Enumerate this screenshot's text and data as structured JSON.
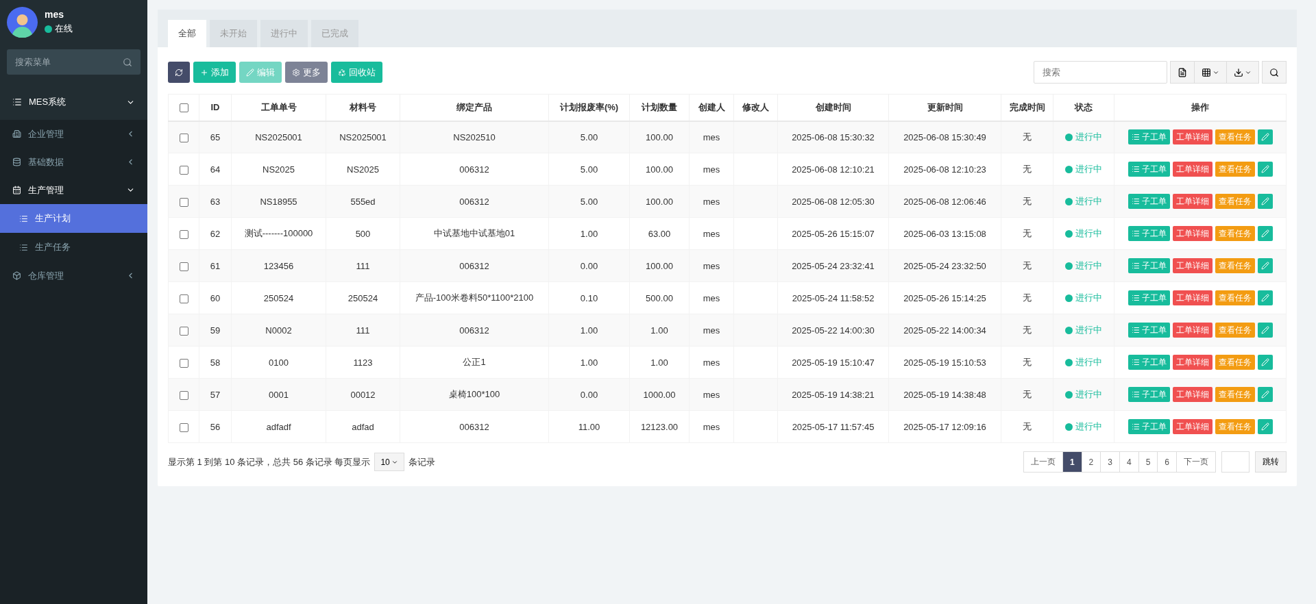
{
  "user": {
    "name": "mes",
    "status": "在线",
    "online": true
  },
  "sidebar": {
    "search_placeholder": "搜索菜单",
    "items": [
      {
        "label": "MES系统",
        "expanded": true,
        "selected": false,
        "children": [
          {
            "label": "企业管理",
            "expanded": false,
            "selected": false
          },
          {
            "label": "基础数据",
            "expanded": false,
            "selected": false
          },
          {
            "label": "生产管理",
            "expanded": true,
            "selected": false,
            "children": [
              {
                "label": "生产计划",
                "selected": true
              },
              {
                "label": "生产任务",
                "selected": false
              }
            ]
          },
          {
            "label": "仓库管理",
            "expanded": false,
            "selected": false
          }
        ]
      }
    ]
  },
  "tabs": [
    {
      "label": "全部",
      "selected": true
    },
    {
      "label": "未开始",
      "selected": false
    },
    {
      "label": "进行中",
      "selected": false
    },
    {
      "label": "已完成",
      "selected": false
    }
  ],
  "toolbar": {
    "buttons": [
      {
        "kind": "refresh",
        "disabled": false
      },
      {
        "kind": "add",
        "label": "添加",
        "disabled": false
      },
      {
        "kind": "edit",
        "label": "编辑",
        "disabled": true
      },
      {
        "kind": "more",
        "label": "更多",
        "disabled": false
      },
      {
        "kind": "recycle",
        "label": "回收站",
        "disabled": false
      }
    ],
    "search_placeholder": "搜索"
  },
  "table": {
    "select_all_checked": false,
    "columns": [
      "ID",
      "工单单号",
      "材料号",
      "绑定产品",
      "计划报废率(%)",
      "计划数量",
      "创建人",
      "修改人",
      "创建时间",
      "更新时间",
      "完成时间",
      "状态",
      "操作"
    ],
    "rows": [
      {
        "checked": false,
        "cells": [
          "65",
          "NS2025001",
          "NS2025001",
          "NS202510",
          "5.00",
          "100.00",
          "mes",
          "",
          "2025-06-08 15:30:32",
          "2025-06-08 15:30:49",
          "无"
        ],
        "status": {
          "kind": "running",
          "label": "进行中"
        },
        "actions": [
          {
            "kind": "sub",
            "label": "子工单"
          },
          {
            "kind": "detail",
            "label": "工单详细"
          },
          {
            "kind": "task",
            "label": "查看任务"
          },
          {
            "kind": "edit"
          }
        ]
      },
      {
        "checked": false,
        "cells": [
          "64",
          "NS2025",
          "NS2025",
          "006312",
          "5.00",
          "100.00",
          "mes",
          "",
          "2025-06-08 12:10:21",
          "2025-06-08 12:10:23",
          "无"
        ],
        "status": {
          "kind": "running",
          "label": "进行中"
        },
        "actions": [
          {
            "kind": "sub",
            "label": "子工单"
          },
          {
            "kind": "detail",
            "label": "工单详细"
          },
          {
            "kind": "task",
            "label": "查看任务"
          },
          {
            "kind": "edit"
          }
        ]
      },
      {
        "checked": false,
        "cells": [
          "63",
          "NS18955",
          "555ed",
          "006312",
          "5.00",
          "100.00",
          "mes",
          "",
          "2025-06-08 12:05:30",
          "2025-06-08 12:06:46",
          "无"
        ],
        "status": {
          "kind": "running",
          "label": "进行中"
        },
        "actions": [
          {
            "kind": "sub",
            "label": "子工单"
          },
          {
            "kind": "detail",
            "label": "工单详细"
          },
          {
            "kind": "task",
            "label": "查看任务"
          },
          {
            "kind": "edit"
          }
        ]
      },
      {
        "checked": false,
        "cells": [
          "62",
          "测试-------100000",
          "500",
          "中试基地中试基地01",
          "1.00",
          "63.00",
          "mes",
          "",
          "2025-05-26 15:15:07",
          "2025-06-03 13:15:08",
          "无"
        ],
        "status": {
          "kind": "running",
          "label": "进行中"
        },
        "actions": [
          {
            "kind": "sub",
            "label": "子工单"
          },
          {
            "kind": "detail",
            "label": "工单详细"
          },
          {
            "kind": "task",
            "label": "查看任务"
          },
          {
            "kind": "edit"
          }
        ]
      },
      {
        "checked": false,
        "cells": [
          "61",
          "123456",
          "111",
          "006312",
          "0.00",
          "100.00",
          "mes",
          "",
          "2025-05-24 23:32:41",
          "2025-05-24 23:32:50",
          "无"
        ],
        "status": {
          "kind": "running",
          "label": "进行中"
        },
        "actions": [
          {
            "kind": "sub",
            "label": "子工单"
          },
          {
            "kind": "detail",
            "label": "工单详细"
          },
          {
            "kind": "task",
            "label": "查看任务"
          },
          {
            "kind": "edit"
          }
        ]
      },
      {
        "checked": false,
        "cells": [
          "60",
          "250524",
          "250524",
          "产品-100米卷料50*1100*2100",
          "0.10",
          "500.00",
          "mes",
          "",
          "2025-05-24 11:58:52",
          "2025-05-26 15:14:25",
          "无"
        ],
        "status": {
          "kind": "running",
          "label": "进行中"
        },
        "actions": [
          {
            "kind": "sub",
            "label": "子工单"
          },
          {
            "kind": "detail",
            "label": "工单详细"
          },
          {
            "kind": "task",
            "label": "查看任务"
          },
          {
            "kind": "edit"
          }
        ]
      },
      {
        "checked": false,
        "cells": [
          "59",
          "N0002",
          "111",
          "006312",
          "1.00",
          "1.00",
          "mes",
          "",
          "2025-05-22 14:00:30",
          "2025-05-22 14:00:34",
          "无"
        ],
        "status": {
          "kind": "running",
          "label": "进行中"
        },
        "actions": [
          {
            "kind": "sub",
            "label": "子工单"
          },
          {
            "kind": "detail",
            "label": "工单详细"
          },
          {
            "kind": "task",
            "label": "查看任务"
          },
          {
            "kind": "edit"
          }
        ]
      },
      {
        "checked": false,
        "cells": [
          "58",
          "0100",
          "1123",
          "公正1",
          "1.00",
          "1.00",
          "mes",
          "",
          "2025-05-19 15:10:47",
          "2025-05-19 15:10:53",
          "无"
        ],
        "status": {
          "kind": "running",
          "label": "进行中"
        },
        "actions": [
          {
            "kind": "sub",
            "label": "子工单"
          },
          {
            "kind": "detail",
            "label": "工单详细"
          },
          {
            "kind": "task",
            "label": "查看任务"
          },
          {
            "kind": "edit"
          }
        ]
      },
      {
        "checked": false,
        "cells": [
          "57",
          "0001",
          "00012",
          "桌椅100*100",
          "0.00",
          "1000.00",
          "mes",
          "",
          "2025-05-19 14:38:21",
          "2025-05-19 14:38:48",
          "无"
        ],
        "status": {
          "kind": "running",
          "label": "进行中"
        },
        "actions": [
          {
            "kind": "sub",
            "label": "子工单"
          },
          {
            "kind": "detail",
            "label": "工单详细"
          },
          {
            "kind": "task",
            "label": "查看任务"
          },
          {
            "kind": "edit"
          }
        ]
      },
      {
        "checked": false,
        "cells": [
          "56",
          "adfadf",
          "adfad",
          "006312",
          "11.00",
          "12123.00",
          "mes",
          "",
          "2025-05-17 11:57:45",
          "2025-05-17 12:09:16",
          "无"
        ],
        "status": {
          "kind": "running",
          "label": "进行中"
        },
        "actions": [
          {
            "kind": "sub",
            "label": "子工单"
          },
          {
            "kind": "detail",
            "label": "工单详细"
          },
          {
            "kind": "task",
            "label": "查看任务"
          },
          {
            "kind": "edit"
          }
        ]
      }
    ]
  },
  "footer": {
    "summary_before": "显示第 1 到第 10 条记录，总共 56 条记录 每页显示",
    "page_size": "10",
    "summary_after": "条记录"
  },
  "pagination": {
    "prev": "上一页",
    "pages": [
      {
        "label": "1",
        "selected": true
      },
      {
        "label": "2",
        "selected": false
      },
      {
        "label": "3",
        "selected": false
      },
      {
        "label": "4",
        "selected": false
      },
      {
        "label": "5",
        "selected": false
      },
      {
        "label": "6",
        "selected": false
      }
    ],
    "next": "下一页",
    "jump": "跳转"
  }
}
